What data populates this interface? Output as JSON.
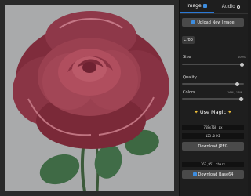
{
  "tabs": [
    {
      "label": "Image",
      "icon": "image-icon"
    },
    {
      "label": "Audio",
      "icon": "search-icon"
    }
  ],
  "upload_label": "Upload New Image",
  "crop_label": "Crop",
  "controls": {
    "size": {
      "label": "Size",
      "value_text": "100%",
      "level": 1.0
    },
    "quality": {
      "label": "Quality",
      "level": 0.92
    },
    "colors": {
      "label": "Colors",
      "value_text": "16M / 16M",
      "level": 0.98
    }
  },
  "magic_label": "Use Magic",
  "dimensions": "768x768 px",
  "filesize": "123.0 KB",
  "download_jpeg_label": "Download JPEG",
  "char_count": "167,951 chars",
  "download_base64_label": "Download Base64",
  "colors": {
    "accent": "#2a78d6",
    "panel": "#1e1e1e",
    "canvas": "#a8a9aa"
  }
}
